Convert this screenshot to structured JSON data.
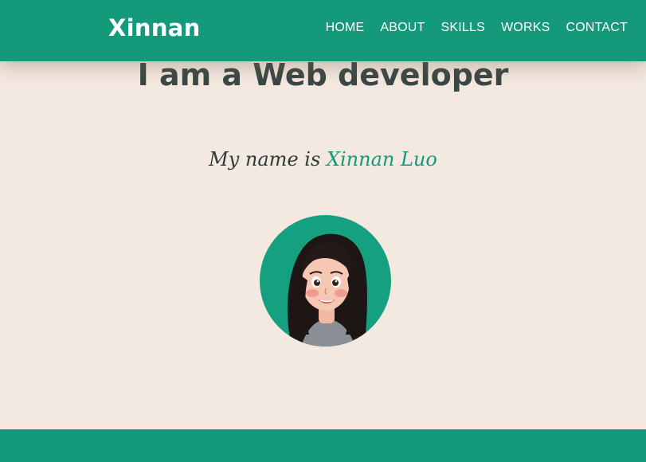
{
  "header": {
    "brand": "Xinnan",
    "nav": [
      {
        "label": "HOME"
      },
      {
        "label": "ABOUT"
      },
      {
        "label": "SKILLS"
      },
      {
        "label": "WORKS"
      },
      {
        "label": "CONTACT"
      }
    ]
  },
  "hero": {
    "title": "I am a Web developer",
    "intro_prefix": "My name is ",
    "intro_name": "Xinnan Luo"
  },
  "colors": {
    "accent": "#14997a",
    "background": "#f4e9e1",
    "heading": "#3a4644"
  },
  "icons": {
    "avatar": "cartoon-portrait"
  }
}
